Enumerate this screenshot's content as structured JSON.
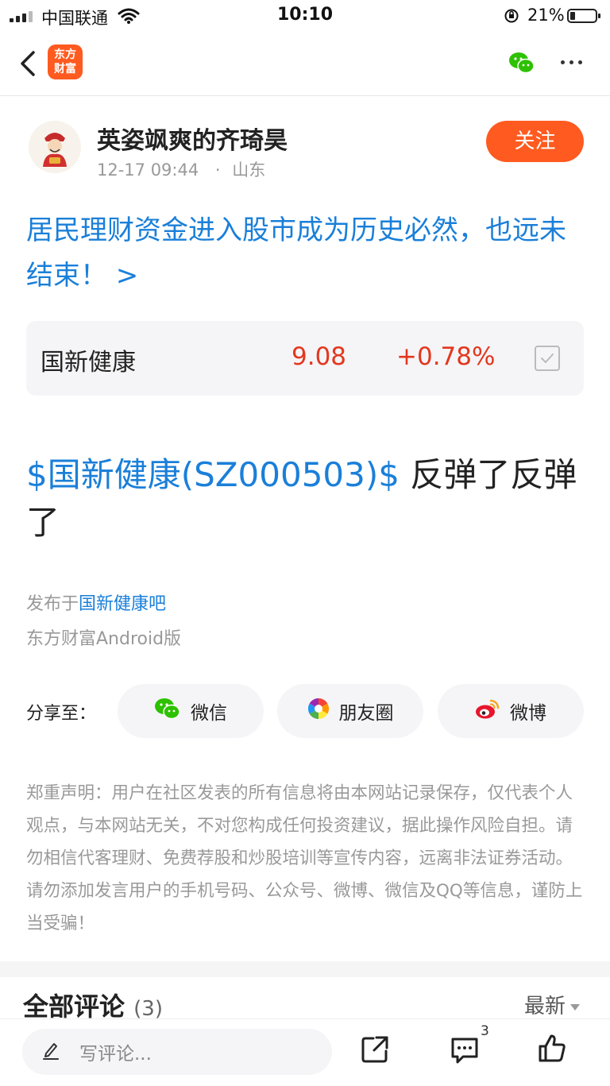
{
  "status_bar": {
    "carrier": "中国联通",
    "time": "10:10",
    "battery": "21%",
    "battery_level": 0.21
  },
  "nav": {
    "logo_line1": "东方",
    "logo_line2": "财富",
    "icons": [
      "back-arrow-icon",
      "wechat-icon",
      "more-icon"
    ]
  },
  "author": {
    "name": "英姿飒爽的齐琦昊",
    "time": "12-17 09:44",
    "separator": "·",
    "location": "山东",
    "follow_label": "关注"
  },
  "topic": {
    "title": "居民理财资金进入股市成为历史必然，也远未结束！ >"
  },
  "stock": {
    "name": "国新健康",
    "price": "9.08",
    "change": "+0.78%"
  },
  "post": {
    "stock_link": "$国新健康(SZ000503)$",
    "text": " 反弹了反弹了"
  },
  "publish": {
    "prefix": "发布于",
    "forum": "国新健康吧",
    "client": "东方财富Android版"
  },
  "share": {
    "label": "分享至：",
    "wechat": "微信",
    "moments": "朋友圈",
    "weibo": "微博"
  },
  "disclaimer": "郑重声明：用户在社区发表的所有信息将由本网站记录保存，仅代表个人观点，与本网站无关，不对您构成任何投资建议，据此操作风险自担。请勿相信代客理财、免费荐股和炒股培训等宣传内容，远离非法证券活动。请勿添加发言用户的手机号码、公众号、微博、微信及QQ等信息，谨防上当受骗！",
  "comments": {
    "title": "全部评论",
    "count": "(3)",
    "sort": "最新"
  },
  "bottom_bar": {
    "placeholder": "写评论...",
    "comment_badge": "3"
  },
  "colors": {
    "brand": "#ff5a1f",
    "link": "#1a7fd9",
    "up": "#e3371e"
  }
}
